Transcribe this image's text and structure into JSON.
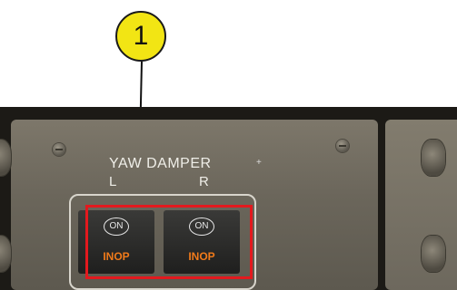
{
  "callout": {
    "number": "1",
    "color": "#f2e514"
  },
  "panel": {
    "title": "YAW DAMPER",
    "plus_mark": "+",
    "left_label": "L",
    "right_label": "R",
    "switches": [
      {
        "on_text": "ON",
        "inop_text": "INOP"
      },
      {
        "on_text": "ON",
        "inop_text": "INOP"
      }
    ],
    "highlight_color": "#e3191e",
    "inop_color": "#f07a1a"
  }
}
